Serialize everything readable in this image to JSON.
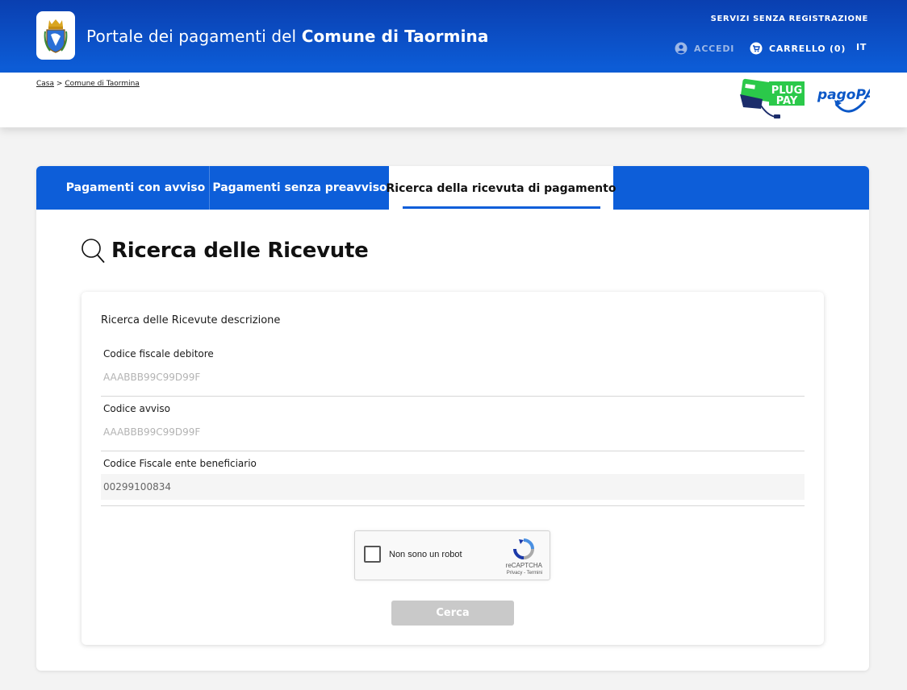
{
  "header": {
    "title_regular": "Portale dei pagamenti del ",
    "title_bold": "Comune di Taormina",
    "services_link": "SERVIZI SENZA REGISTRAZIONE",
    "login_label": "ACCEDI",
    "cart_label": "CARRELLO (0)",
    "language": "IT",
    "logo_icon": "coat-of-arms-icon"
  },
  "breadcrumb": {
    "items": [
      "Casa",
      "Comune di Taormina"
    ],
    "separator": ">"
  },
  "partners": {
    "plugpay_text_1": "PLUG",
    "plugpay_text_2": "PAY",
    "pagopa_text": "pagoPA"
  },
  "tabs": [
    {
      "label": "Pagamenti con avviso",
      "active": false
    },
    {
      "label": "Pagamenti senza preavviso",
      "active": false
    },
    {
      "label": "Ricerca della ricevuta di pagamento",
      "active": true
    }
  ],
  "page": {
    "heading": "Ricerca delle Ricevute",
    "heading_icon": "search-icon",
    "description": "Ricerca delle Ricevute descrizione"
  },
  "form": {
    "debtor_tax_code": {
      "label": "Codice fiscale debitore",
      "placeholder": "AAABBB99C99D99F",
      "value": ""
    },
    "notice_code": {
      "label": "Codice avviso",
      "placeholder": "AAABBB99C99D99F",
      "value": ""
    },
    "beneficiary_tax_code": {
      "label": "Codice Fiscale ente beneficiario",
      "placeholder": "",
      "value": "00299100834"
    },
    "captcha": {
      "label": "Non sono un robot",
      "brand": "reCAPTCHA",
      "terms": "Privacy - Termini"
    },
    "submit_label": "Cerca"
  },
  "colors": {
    "primary": "#0d5ed9",
    "header_dark": "#0a3fb0",
    "disabled_button": "#c9c9c9",
    "plugpay_green": "#2bc94a"
  }
}
